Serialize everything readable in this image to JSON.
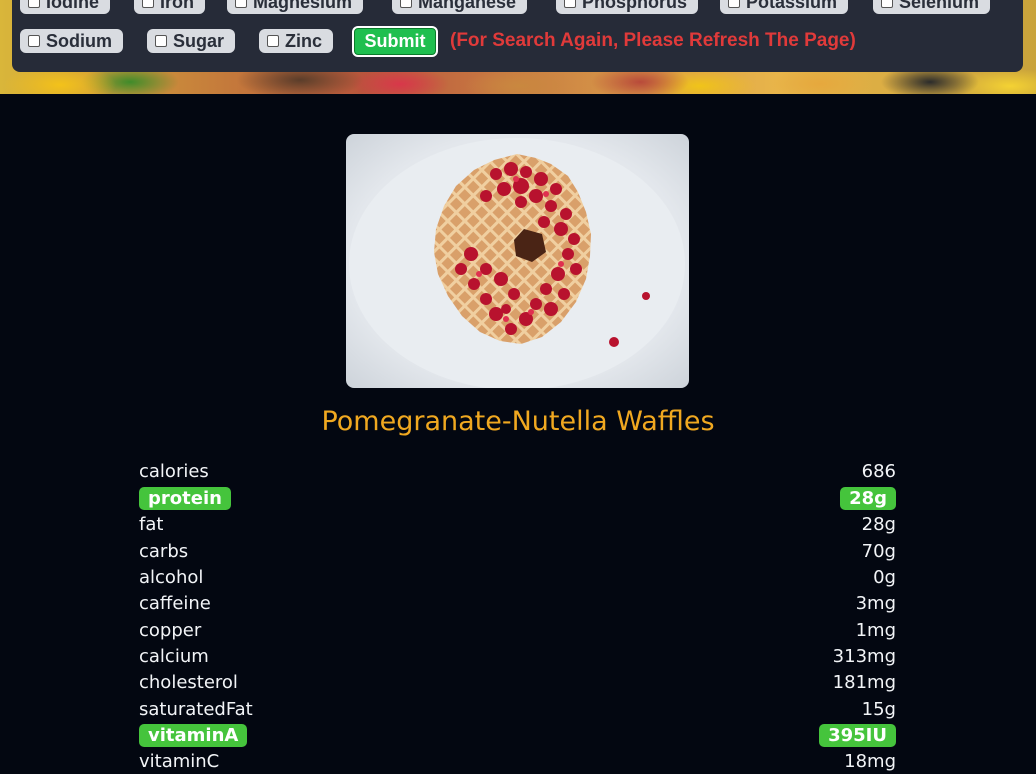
{
  "filters": {
    "row1": [
      "Iodine",
      "Iron",
      "Magnesium",
      "Manganese",
      "Phosphorus",
      "Potassium",
      "Selenium"
    ],
    "row2": [
      "Sodium",
      "Sugar",
      "Zinc"
    ],
    "submit_label": "Submit",
    "notice": "(For Search Again, Please Refresh The Page)"
  },
  "recipe": {
    "title": "Pomegranate-Nutella Waffles",
    "image_subject": "waffle topped with pomegranate seeds and nutella",
    "nutrients": [
      {
        "name": "calories",
        "value": "686",
        "highlight": false
      },
      {
        "name": "protein",
        "value": "28g",
        "highlight": true
      },
      {
        "name": "fat",
        "value": "28g",
        "highlight": false
      },
      {
        "name": "carbs",
        "value": "70g",
        "highlight": false
      },
      {
        "name": "alcohol",
        "value": "0g",
        "highlight": false
      },
      {
        "name": "caffeine",
        "value": "3mg",
        "highlight": false
      },
      {
        "name": "copper",
        "value": "1mg",
        "highlight": false
      },
      {
        "name": "calcium",
        "value": "313mg",
        "highlight": false
      },
      {
        "name": "cholesterol",
        "value": "181mg",
        "highlight": false
      },
      {
        "name": "saturatedFat",
        "value": "15g",
        "highlight": false
      },
      {
        "name": "vitaminA",
        "value": "395IU",
        "highlight": true
      },
      {
        "name": "vitaminC",
        "value": "18mg",
        "highlight": false
      }
    ]
  },
  "colors": {
    "title": "#f0a820",
    "highlight": "#45c43c",
    "submit": "#1fbf4f",
    "notice": "#e03a3a",
    "panel": "#262b38",
    "background": "#030711"
  }
}
